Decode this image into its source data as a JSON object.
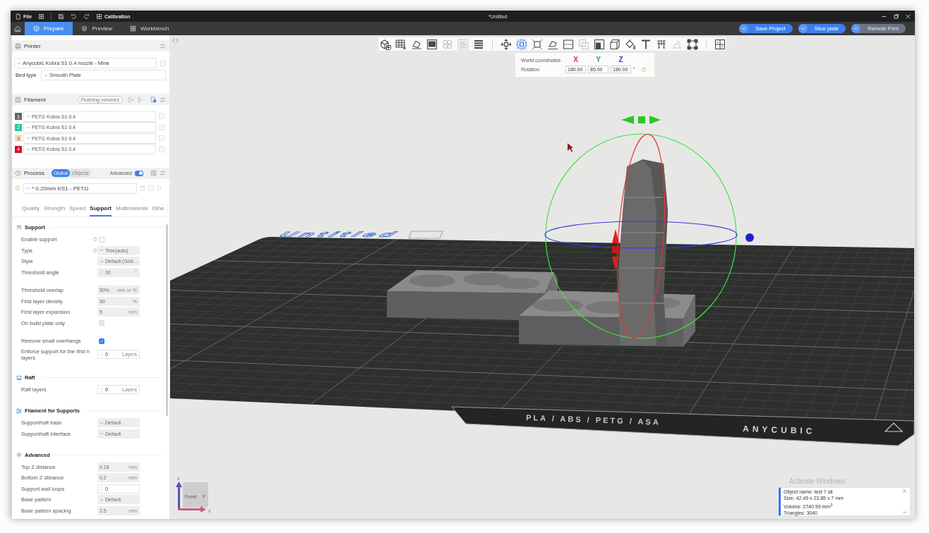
{
  "window": {
    "title": "*Untitled"
  },
  "quick_bar": [
    {
      "kind": "file",
      "label": "File"
    },
    {
      "kind": "panel"
    },
    {
      "kind": "save"
    },
    {
      "kind": "undo"
    },
    {
      "kind": "redo"
    },
    {
      "kind": "calibration",
      "label": "Calibration"
    }
  ],
  "tabs": [
    {
      "kind": "prepare",
      "label": "Prepare",
      "selected": true
    },
    {
      "kind": "preview",
      "label": "Preview",
      "selected": false
    },
    {
      "kind": "workbench",
      "label": "Workbench",
      "selected": false
    }
  ],
  "actions": [
    {
      "label": "Save Project",
      "disabled": false
    },
    {
      "label": "Slice plate",
      "disabled": false
    },
    {
      "label": "Remote Print",
      "disabled": true
    }
  ],
  "printer": {
    "title": "Printer",
    "preset": "Anycubic Kobra S1 0.4 nozzle - Mine",
    "bed_type_label": "Bed type",
    "bed_type": "Smooth Plate"
  },
  "filament": {
    "title": "Filament",
    "flushing_button": "Flushing volumes",
    "items": [
      {
        "number": "1",
        "name": "PETG Kobra S1 0.4",
        "color": "#666666"
      },
      {
        "number": "2",
        "name": "PETG Kobra S1 0.4",
        "color": "#1fc8a0"
      },
      {
        "number": "3",
        "name": "PETG Kobra S1 0.4",
        "color": "#efe3c2"
      },
      {
        "number": "4",
        "name": "PETG Kobra S1 0.4",
        "color": "#d2122e"
      }
    ]
  },
  "process": {
    "title": "Process",
    "scopes": [
      {
        "label": "Global",
        "selected": true
      },
      {
        "label": "Objects",
        "selected": false
      }
    ],
    "advanced_label": "Advanced",
    "advanced_on": true,
    "preset": "* 0.20mm KS1 - PETG",
    "tabs": [
      {
        "label": "Quality",
        "selected": false
      },
      {
        "label": "Strength",
        "selected": false
      },
      {
        "label": "Speed",
        "selected": false
      },
      {
        "label": "Support",
        "selected": true
      },
      {
        "label": "Multimaterial",
        "selected": false
      },
      {
        "label": "Othe…",
        "selected": false
      }
    ]
  },
  "settings": [
    {
      "kind": "support",
      "title": "Support",
      "groups": [
        [
          {
            "label": "Enable support",
            "kind": "checkbox",
            "checked": false,
            "disabled": false,
            "reset": true
          },
          {
            "label": "Type",
            "kind": "dropdown",
            "value": "Tree(auto)",
            "disabled": true,
            "reset": true
          },
          {
            "label": "Style",
            "kind": "dropdown",
            "value": "Default (Grid…",
            "disabled": true
          },
          {
            "label": "Threshold angle",
            "kind": "spin",
            "value": "30",
            "unit": "°",
            "disabled": true
          }
        ],
        [
          {
            "label": "Threshold overlap",
            "kind": "number",
            "value": "50%",
            "unit": "mm or %",
            "disabled": true
          },
          {
            "label": "First layer density",
            "kind": "number",
            "value": "90",
            "unit": "%",
            "disabled": true
          },
          {
            "label": "First layer expansion",
            "kind": "number",
            "value": "5",
            "unit": "mm",
            "disabled": true
          },
          {
            "label": "On build plate only",
            "kind": "checkbox",
            "checked": false,
            "disabled": true
          }
        ],
        [
          {
            "label": "Remove small overhangs",
            "kind": "checkbox",
            "checked": true,
            "disabled": false
          },
          {
            "label": "Enforce support for the first n layers",
            "kind": "spin",
            "value": "0",
            "unit": "Layers",
            "disabled": false
          }
        ]
      ]
    },
    {
      "kind": "raft",
      "title": "Raft",
      "groups": [
        [
          {
            "label": "Raft layers",
            "kind": "spin",
            "value": "0",
            "unit": "Layers",
            "disabled": false
          }
        ]
      ]
    },
    {
      "kind": "filament",
      "title": "Filament for Supports",
      "groups": [
        [
          {
            "label": "Support/raft base",
            "kind": "dropdown",
            "value": "Default",
            "disabled": true
          },
          {
            "label": "Support/raft interface",
            "kind": "dropdown",
            "value": "Default",
            "disabled": true
          }
        ]
      ]
    },
    {
      "kind": "advanced",
      "title": "Advanced",
      "groups": [
        [
          {
            "label": "Top Z distance",
            "kind": "number",
            "value": "0.18",
            "unit": "mm",
            "disabled": true
          },
          {
            "label": "Bottom Z distance",
            "kind": "number",
            "value": "0.2",
            "unit": "mm",
            "disabled": true
          },
          {
            "label": "Support wall loops",
            "kind": "spin",
            "value": "0",
            "disabled": false
          },
          {
            "label": "Base pattern",
            "kind": "dropdown",
            "value": "Default",
            "disabled": true
          },
          {
            "label": "Base pattern spacing",
            "kind": "number",
            "value": "2.5",
            "unit": "mm",
            "disabled": true
          }
        ]
      ]
    }
  ],
  "viewport": {
    "toolbar": [
      [
        {
          "kind": "cube",
          "selected": false,
          "disabled": false
        },
        {
          "kind": "grid",
          "selected": false,
          "disabled": false
        },
        {
          "kind": "orient",
          "selected": false,
          "disabled": false
        },
        {
          "kind": "picture",
          "selected": false,
          "disabled": false
        },
        {
          "kind": "arrange",
          "selected": false,
          "disabled": true
        },
        {
          "kind": "arrangeall",
          "selected": false,
          "disabled": true
        },
        {
          "kind": "layers",
          "selected": false,
          "disabled": false
        }
      ],
      [
        {
          "kind": "move",
          "selected": false,
          "disabled": false
        },
        {
          "kind": "rotate",
          "selected": true,
          "disabled": false
        },
        {
          "kind": "scale",
          "selected": false,
          "disabled": false
        },
        {
          "kind": "layflat",
          "selected": false,
          "disabled": false
        },
        {
          "kind": "cut",
          "selected": false,
          "disabled": false
        },
        {
          "kind": "boolean",
          "selected": false,
          "disabled": true
        },
        {
          "kind": "split",
          "selected": false,
          "disabled": false
        },
        {
          "kind": "box",
          "selected": false,
          "disabled": false
        },
        {
          "kind": "paint",
          "selected": false,
          "disabled": false
        },
        {
          "kind": "text",
          "selected": false,
          "disabled": false
        },
        {
          "kind": "supports",
          "selected": false,
          "disabled": false
        },
        {
          "kind": "seam",
          "selected": false,
          "disabled": true
        },
        {
          "kind": "measure",
          "selected": false,
          "disabled": false
        }
      ],
      [
        {
          "kind": "assembly",
          "selected": false,
          "disabled": false
        }
      ]
    ],
    "rotation_panel": {
      "header": "World coordinates",
      "axes": [
        {
          "label": "X",
          "color": "#d03a3a"
        },
        {
          "label": "Y",
          "color": "#3aa04a"
        },
        {
          "label": "Z",
          "color": "#4040c8"
        }
      ],
      "label": "Rotation",
      "values": [
        "180.00",
        "85.00",
        "180.00"
      ],
      "unit": "°"
    },
    "scene": {
      "plate_name": "Untitled",
      "bed_texts": [
        "PLA / ABS / PETG / ASA",
        "ANYCUBIC"
      ]
    },
    "view_cube": {
      "face": "Front",
      "side": "F",
      "axes": [
        {
          "label": "z",
          "color": "#5a4fb4"
        },
        {
          "label": "x",
          "color": "#c8607c"
        }
      ]
    },
    "os_notice": "Activate Windows",
    "object_info": {
      "lines": [
        "Object name: test 7.stl",
        "Size: 42.45 x 23.85 x 7 mm",
        "Volume: 2740.99 mm$^{3}$",
        "Triangles: 3040"
      ]
    }
  }
}
